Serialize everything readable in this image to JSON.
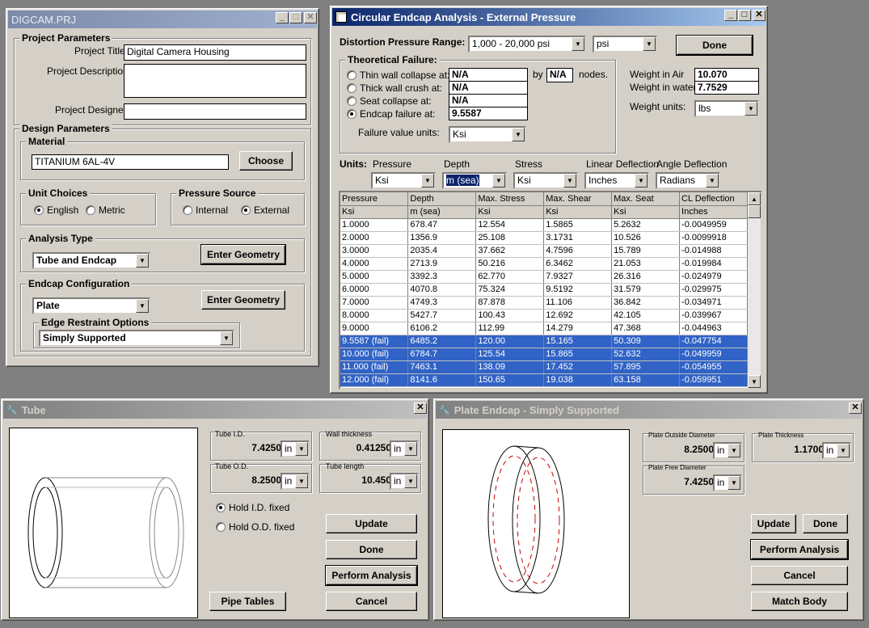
{
  "project_win": {
    "title": "DIGCAM.PRJ",
    "group_project": "Project Parameters",
    "title_label": "Project Title",
    "title_value": "Digital Camera Housing",
    "desc_label": "Project Description",
    "designer_label": "Project Designer",
    "group_design": "Design Parameters",
    "group_material": "Material",
    "material_value": "TITANIUM 6AL-4V",
    "choose_button": "Choose",
    "group_units": "Unit Choices",
    "unit_english": "English",
    "unit_metric": "Metric",
    "group_pressure": "Pressure Source",
    "pressure_internal": "Internal",
    "pressure_external": "External",
    "group_analysis": "Analysis Type",
    "analysis_value": "Tube and Endcap",
    "enter_geometry_1": "Enter Geometry",
    "group_endcap": "Endcap Configuration",
    "endcap_value": "Plate",
    "enter_geometry_2": "Enter Geometry",
    "group_edge": "Edge Restraint Options",
    "edge_value": "Simply Supported"
  },
  "analysis_win": {
    "title": "Circular Endcap Analysis - External Pressure",
    "range_label": "Distortion Pressure Range:",
    "range_value": "1,000 - 20,000 psi",
    "range_unit": "psi",
    "done_button": "Done",
    "failure_group": "Theoretical Failure:",
    "thin_wall": "Thin wall collapse at:",
    "thick_wall": "Thick wall crush at:",
    "seat_collapse": "Seat collapse at:",
    "endcap_failure": "Endcap failure at:",
    "thin_val": "N/A",
    "thick_val": "N/A",
    "seat_val": "N/A",
    "endcap_val": "9.5587",
    "by_label": "by",
    "nodes_val": "N/A",
    "nodes_label": "nodes.",
    "failure_units_label": "Failure value units:",
    "failure_units_value": "Ksi",
    "weight_air_label": "Weight in Air",
    "weight_air_value": "10.070",
    "weight_water_label": "Weight in water:",
    "weight_water_value": "7.7529",
    "weight_units_label": "Weight units:",
    "weight_units_value": "lbs",
    "units_label": "Units:",
    "u_pressure_label": "Pressure",
    "u_pressure_value": "Ksi",
    "u_depth_label": "Depth",
    "u_depth_value": "m (sea)",
    "u_stress_label": "Stress",
    "u_stress_value": "Ksi",
    "u_lin_label": "Linear Deflection",
    "u_lin_value": "Inches",
    "u_ang_label": "Angle Deflection",
    "u_ang_value": "Radians",
    "columns": [
      "Pressure",
      "Depth",
      "Max. Stress",
      "Max. Shear",
      "Max. Seat",
      "CL Deflection"
    ],
    "units_row": [
      "Ksi",
      "m (sea)",
      "Ksi",
      "Ksi",
      "Ksi",
      "Inches"
    ],
    "rows": [
      [
        "1.0000",
        "678.47",
        "12.554",
        "1.5865",
        "5.2632",
        "-0.0049959"
      ],
      [
        "2.0000",
        "1356.9",
        "25.108",
        "3.1731",
        "10.526",
        "-0.0099918"
      ],
      [
        "3.0000",
        "2035.4",
        "37.662",
        "4.7596",
        "15.789",
        "-0.014988"
      ],
      [
        "4.0000",
        "2713.9",
        "50.216",
        "6.3462",
        "21.053",
        "-0.019984"
      ],
      [
        "5.0000",
        "3392.3",
        "62.770",
        "7.9327",
        "26.316",
        "-0.024979"
      ],
      [
        "6.0000",
        "4070.8",
        "75.324",
        "9.5192",
        "31.579",
        "-0.029975"
      ],
      [
        "7.0000",
        "4749.3",
        "87.878",
        "11.106",
        "36.842",
        "-0.034971"
      ],
      [
        "8.0000",
        "5427.7",
        "100.43",
        "12.692",
        "42.105",
        "-0.039967"
      ],
      [
        "9.0000",
        "6106.2",
        "112.99",
        "14.279",
        "47.368",
        "-0.044963"
      ],
      [
        "9.5587 (fail)",
        "6485.2",
        "120.00",
        "15.165",
        "50.309",
        "-0.047754"
      ],
      [
        "10.000 (fail)",
        "6784.7",
        "125.54",
        "15.865",
        "52.632",
        "-0.049959"
      ],
      [
        "11.000 (fail)",
        "7463.1",
        "138.09",
        "17.452",
        "57.895",
        "-0.054955"
      ],
      [
        "12.000 (fail)",
        "8141.6",
        "150.65",
        "19.038",
        "63.158",
        "-0.059951"
      ]
    ]
  },
  "tube_win": {
    "title": "Tube",
    "id_label": "Tube I.D.",
    "id_value": "7.4250",
    "id_unit": "in",
    "wall_label": "Wall thickness",
    "wall_value": "0.41250",
    "wall_unit": "in",
    "od_label": "Tube O.D.",
    "od_value": "8.2500",
    "od_unit": "in",
    "len_label": "Tube length",
    "len_value": "10.450",
    "len_unit": "in",
    "hold_id": "Hold I.D. fixed",
    "hold_od": "Hold O.D. fixed",
    "update_button": "Update",
    "done_button": "Done",
    "perform_button": "Perform Analysis",
    "pipe_button": "Pipe Tables",
    "cancel_button": "Cancel"
  },
  "plate_win": {
    "title": "Plate Endcap - Simply Supported",
    "od_label": "Plate Outside Diameter",
    "od_value": "8.2500",
    "od_unit": "in",
    "thick_label": "Plate Thickness",
    "thick_value": "1.1700",
    "thick_unit": "in",
    "free_label": "Plate Free Diameter",
    "free_value": "7.4250",
    "free_unit": "in",
    "update_button": "Update",
    "done_button": "Done",
    "perform_button": "Perform Analysis",
    "cancel_button": "Cancel",
    "match_button": "Match Body"
  }
}
